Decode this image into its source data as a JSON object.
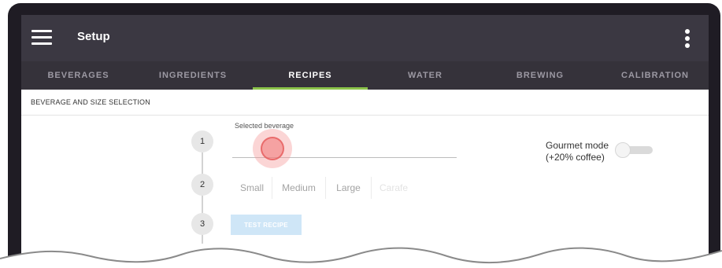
{
  "app": {
    "title": "Setup",
    "menu_icon": "hamburger-menu-icon",
    "overflow_icon": "vertical-dots-icon"
  },
  "tabs": [
    {
      "label": "BEVERAGES",
      "active": false
    },
    {
      "label": "INGREDIENTS",
      "active": false
    },
    {
      "label": "RECIPES",
      "active": true
    },
    {
      "label": "WATER",
      "active": false
    },
    {
      "label": "BREWING",
      "active": false
    },
    {
      "label": "CALIBRATION",
      "active": false
    }
  ],
  "section": {
    "title": "BEVERAGE AND SIZE SELECTION"
  },
  "steps": [
    "1",
    "2",
    "3"
  ],
  "beverage_field": {
    "label": "Selected beverage",
    "value": ""
  },
  "sizes": [
    {
      "label": "Small",
      "enabled": true
    },
    {
      "label": "Medium",
      "enabled": true
    },
    {
      "label": "Large",
      "enabled": true
    },
    {
      "label": "Carafe",
      "enabled": false
    }
  ],
  "test_button": {
    "label": "TEST RECIPE",
    "enabled": false
  },
  "gourmet": {
    "line1": "Gourmet mode",
    "line2": "(+20% coffee)",
    "on": false
  },
  "colors": {
    "appbar": "#3b3842",
    "tabbar": "#35323a",
    "tab_indicator": "#8bc34a",
    "test_button": "#cfe6f7",
    "touch_indicator": "#f08c8c"
  }
}
